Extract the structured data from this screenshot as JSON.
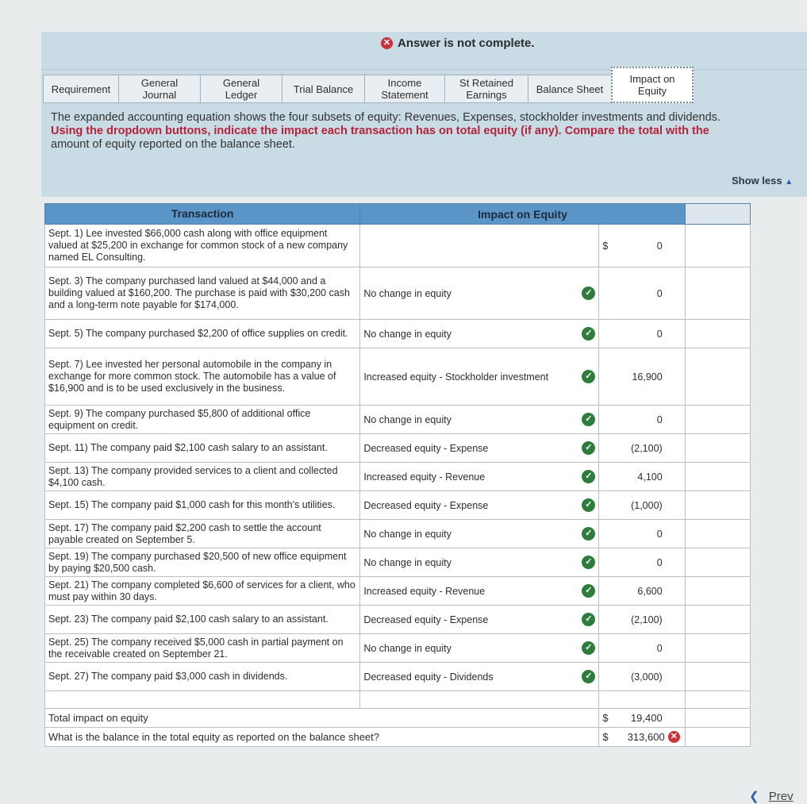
{
  "banner": {
    "message": "Answer is not complete."
  },
  "tabs": [
    {
      "label": "Requirement"
    },
    {
      "label": "General\nJournal"
    },
    {
      "label": "General\nLedger"
    },
    {
      "label": "Trial Balance"
    },
    {
      "label": "Income\nStatement"
    },
    {
      "label": "St Retained\nEarnings"
    },
    {
      "label": "Balance Sheet"
    },
    {
      "label": "Impact on\nEquity"
    }
  ],
  "instructions": {
    "line1": "The expanded accounting equation shows the four subsets of equity: Revenues, Expenses, stockholder investments and dividends.",
    "line2": "Using the dropdown buttons, indicate the impact each transaction has on total equity (if any). Compare the total with the",
    "line3": "amount of equity reported on the balance sheet."
  },
  "show_less": "Show less",
  "table": {
    "headers": {
      "transaction": "Transaction",
      "impact": "Impact on Equity"
    },
    "rows": [
      {
        "transaction": "Sept. 1) Lee invested $66,000 cash along with office equipment valued at $25,200 in exchange for common stock of a new company named EL Consulting.",
        "impact": "",
        "dollar": "$",
        "amount": "0"
      },
      {
        "transaction": "Sept. 3) The company purchased land valued at $44,000 and a building valued at $160,200. The purchase is paid with $30,200 cash and a long-term note payable for $174,000.",
        "impact": "No change in equity",
        "dollar": "",
        "amount": "0"
      },
      {
        "transaction": "Sept. 5) The company purchased $2,200 of office supplies on credit.",
        "impact": "No change in equity",
        "dollar": "",
        "amount": "0"
      },
      {
        "transaction": "Sept. 7) Lee invested her personal automobile in the company in exchange for more common stock. The automobile has a value of $16,900 and is to be used exclusively in the business.",
        "impact": "Increased equity - Stockholder investment",
        "dollar": "",
        "amount": "16,900"
      },
      {
        "transaction": "Sept. 9) The company purchased $5,800 of additional office equipment on credit.",
        "impact": "No change in equity",
        "dollar": "",
        "amount": "0"
      },
      {
        "transaction": "Sept. 11) The company paid $2,100 cash salary to an assistant.",
        "impact": "Decreased equity - Expense",
        "dollar": "",
        "amount": "(2,100)"
      },
      {
        "transaction": "Sept. 13) The company provided services to a client and collected $4,100 cash.",
        "impact": "Increased equity - Revenue",
        "dollar": "",
        "amount": "4,100"
      },
      {
        "transaction": "Sept. 15) The company paid $1,000 cash for this month's utilities.",
        "impact": "Decreased equity - Expense",
        "dollar": "",
        "amount": "(1,000)"
      },
      {
        "transaction": "Sept. 17) The company paid $2,200 cash to settle the account payable created on September 5.",
        "impact": "No change in equity",
        "dollar": "",
        "amount": "0"
      },
      {
        "transaction": "Sept. 19) The company purchased $20,500 of new office equipment by paying $20,500 cash.",
        "impact": "No change in equity",
        "dollar": "",
        "amount": "0"
      },
      {
        "transaction": "Sept. 21) The company completed $6,600 of services for a client, who must pay within 30 days.",
        "impact": "Increased equity - Revenue",
        "dollar": "",
        "amount": "6,600"
      },
      {
        "transaction": "Sept. 23) The company paid $2,100 cash salary to an assistant.",
        "impact": "Decreased equity - Expense",
        "dollar": "",
        "amount": "(2,100)"
      },
      {
        "transaction": "Sept. 25) The company received $5,000 cash in partial payment on the receivable created on September 21.",
        "impact": "No change in equity",
        "dollar": "",
        "amount": "0"
      },
      {
        "transaction": "Sept. 27) The company paid $3,000 cash in dividends.",
        "impact": "Decreased equity - Dividends",
        "dollar": "",
        "amount": "(3,000)"
      }
    ],
    "total": {
      "label": "Total impact on equity",
      "dollar": "$",
      "amount": "19,400"
    },
    "balance": {
      "label": "What is the balance in the total equity as reported on the balance sheet?",
      "dollar": "$",
      "amount": "313,600"
    }
  },
  "nav": {
    "prev": "Prev"
  }
}
